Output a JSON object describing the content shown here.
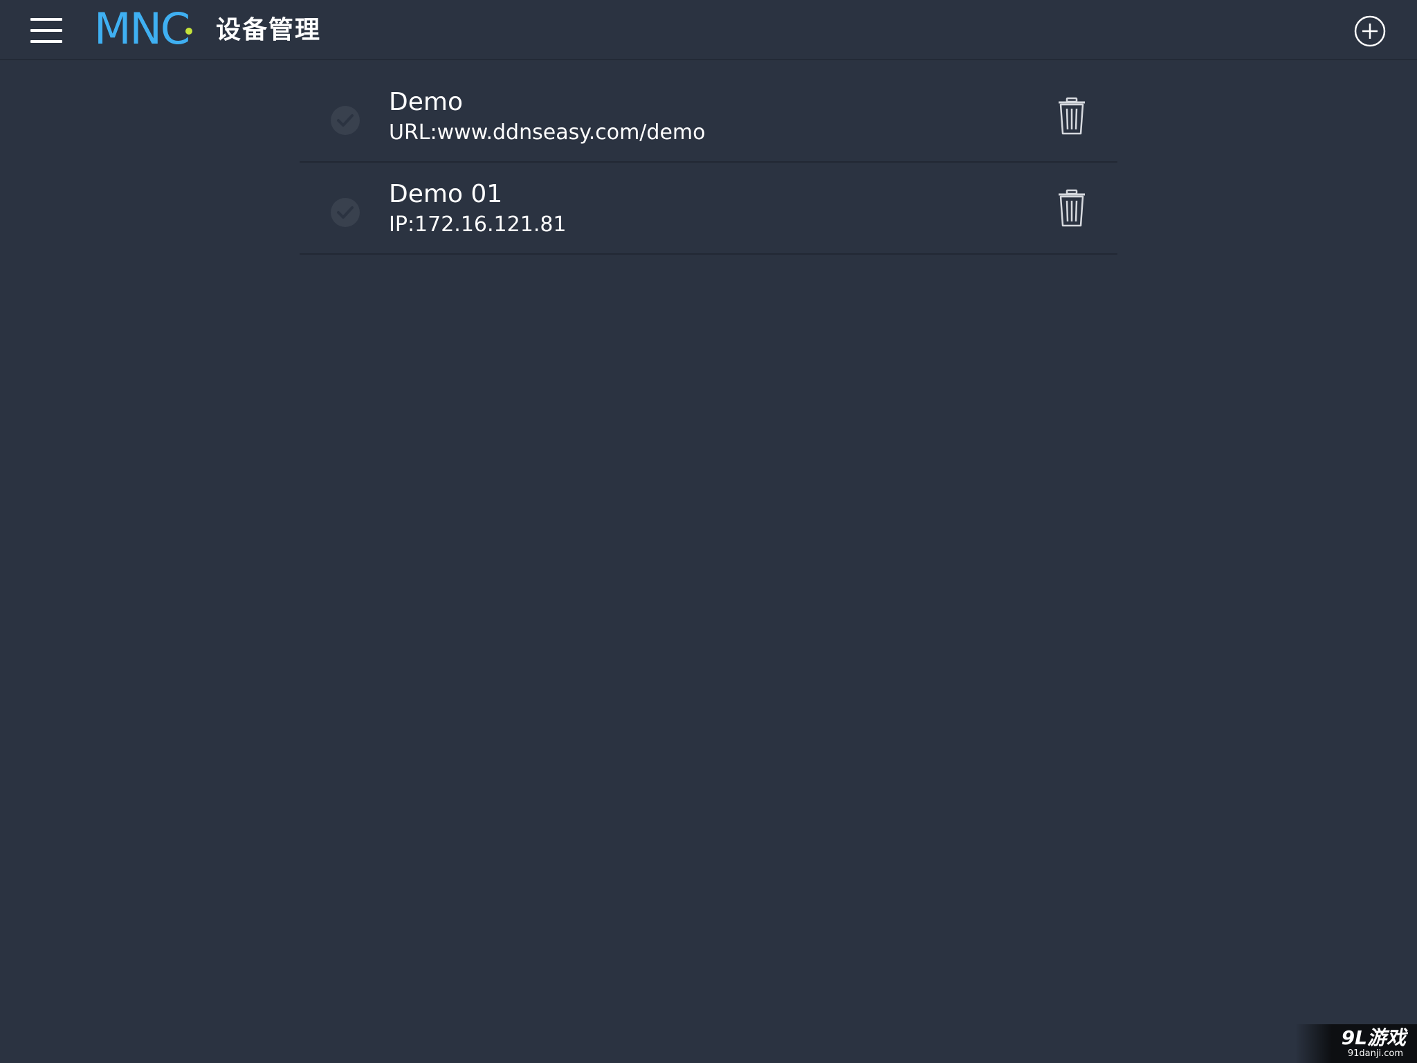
{
  "header": {
    "menu_icon": "hamburger-menu-icon",
    "logo_text": "MNC",
    "logo_dot_color": "#c4e23a",
    "logo_color": "#3fb0f2",
    "title": "设备管理",
    "add_icon": "plus-circle-icon"
  },
  "devices": [
    {
      "name": "Demo",
      "address": "URL:www.ddnseasy.com/demo",
      "check_icon": "check-circle-icon",
      "delete_icon": "trash-icon"
    },
    {
      "name": "Demo 01",
      "address": "IP:172.16.121.81",
      "check_icon": "check-circle-icon",
      "delete_icon": "trash-icon"
    }
  ],
  "watermark": {
    "main": "9L游戏",
    "sub": "91danji.com"
  },
  "colors": {
    "background": "#2b3341",
    "divider": "#222834",
    "check": "#39414e"
  }
}
